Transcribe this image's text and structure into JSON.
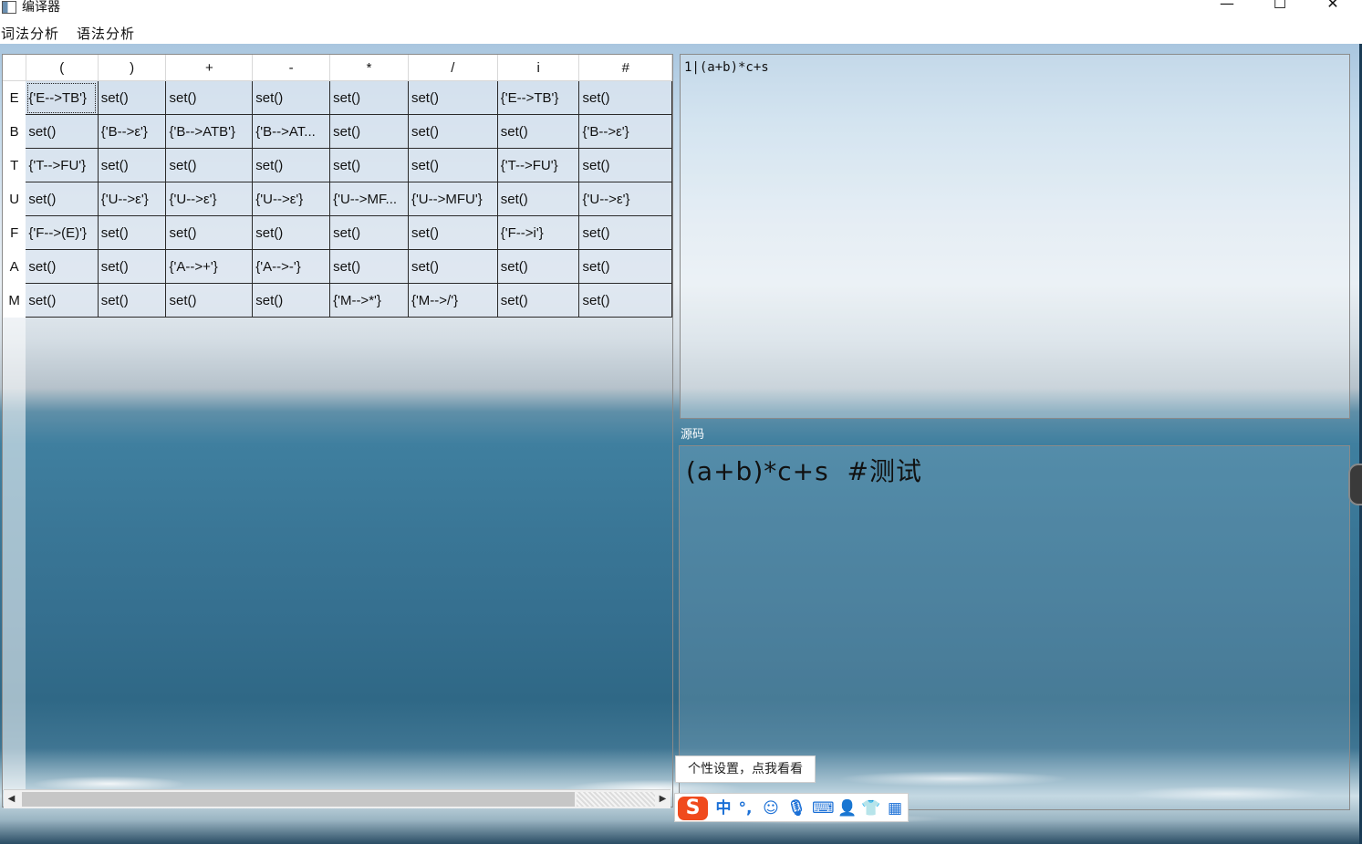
{
  "window": {
    "title": "编译器",
    "controls": {
      "minimize": "—",
      "maximize": "☐",
      "close": "✕"
    }
  },
  "menu": [
    "词法分析",
    "语法分析"
  ],
  "table": {
    "columns": [
      "(",
      ")",
      "+",
      "-",
      "*",
      "/",
      "i",
      "#"
    ],
    "rows": [
      {
        "label": "E",
        "cells": [
          "{'E-->TB'}",
          "set()",
          "set()",
          "set()",
          "set()",
          "set()",
          "{'E-->TB'}",
          "set()"
        ]
      },
      {
        "label": "B",
        "cells": [
          "set()",
          "{'B-->ε'}",
          "{'B-->ATB'}",
          "{'B-->AT...",
          "set()",
          "set()",
          "set()",
          "{'B-->ε'}"
        ]
      },
      {
        "label": "T",
        "cells": [
          "{'T-->FU'}",
          "set()",
          "set()",
          "set()",
          "set()",
          "set()",
          "{'T-->FU'}",
          "set()"
        ]
      },
      {
        "label": "U",
        "cells": [
          "set()",
          "{'U-->ε'}",
          "{'U-->ε'}",
          "{'U-->ε'}",
          "{'U-->MF...",
          "{'U-->MFU'}",
          "set()",
          "{'U-->ε'}"
        ]
      },
      {
        "label": "F",
        "cells": [
          "{'F-->(E)'}",
          "set()",
          "set()",
          "set()",
          "set()",
          "set()",
          "{'F-->i'}",
          "set()"
        ]
      },
      {
        "label": "A",
        "cells": [
          "set()",
          "set()",
          "{'A-->+'}",
          "{'A-->-'}",
          "set()",
          "set()",
          "set()",
          "set()"
        ]
      },
      {
        "label": "M",
        "cells": [
          "set()",
          "set()",
          "set()",
          "set()",
          "{'M-->*'}",
          "{'M-->/'}",
          "set()",
          "set()"
        ]
      }
    ]
  },
  "output": {
    "text": "1|(a+b)*c+s"
  },
  "source": {
    "label": "源码",
    "text": "(a+b)*c+s  #测试"
  },
  "ime": {
    "tip": "个性设置，点我看看",
    "logo": "S",
    "items": [
      {
        "name": "chinese-mode",
        "glyph": "中"
      },
      {
        "name": "punctuation",
        "glyph": "°,"
      },
      {
        "name": "emoji-icon",
        "glyph": "☺"
      },
      {
        "name": "microphone-icon",
        "glyph": "🎙"
      },
      {
        "name": "keyboard-icon",
        "glyph": "⌨"
      },
      {
        "name": "user-icon",
        "glyph": "👤"
      },
      {
        "name": "skin-icon",
        "glyph": "👕"
      },
      {
        "name": "apps-icon",
        "glyph": "▦"
      }
    ]
  },
  "colors": {
    "ime_accent": "#1a6fd6",
    "ime_logo": "#f04a1d"
  }
}
